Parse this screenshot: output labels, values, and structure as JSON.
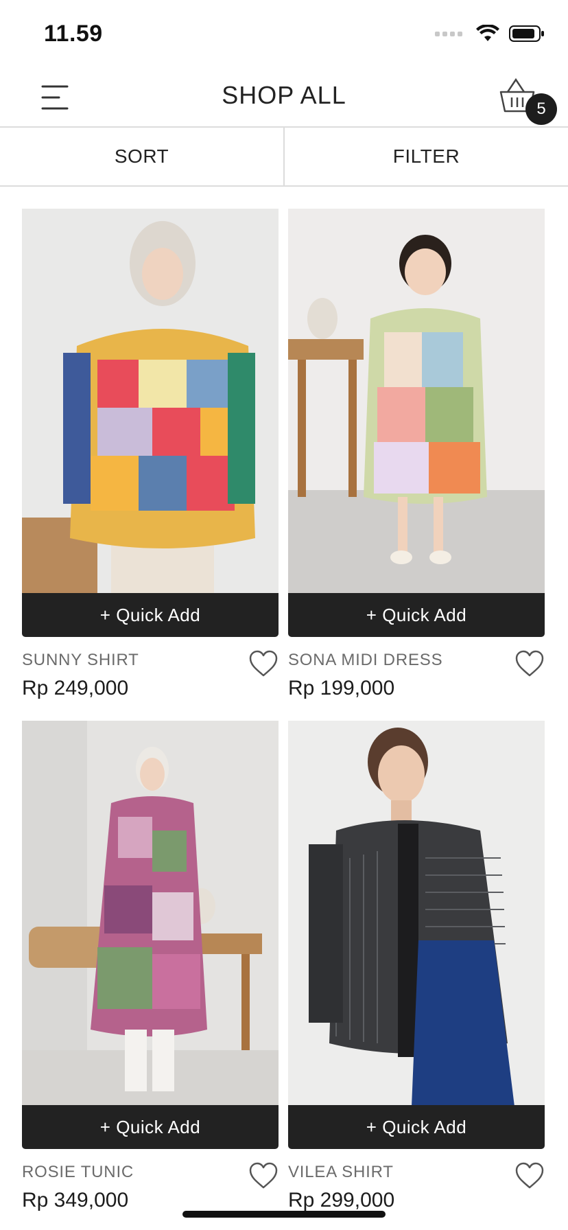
{
  "status_bar": {
    "time": "11.59"
  },
  "header": {
    "title": "SHOP ALL",
    "cart_count": "5",
    "menu_icon": "hamburger-menu-icon",
    "cart_icon": "basket-icon"
  },
  "toolbar": {
    "sort_label": "SORT",
    "filter_label": "FILTER"
  },
  "products": [
    {
      "name": "SUNNY SHIRT",
      "price": "Rp 249,000",
      "quick_add": "+ Quick Add"
    },
    {
      "name": "SONA MIDI DRESS",
      "price": "Rp 199,000",
      "quick_add": "+ Quick Add"
    },
    {
      "name": "ROSIE TUNIC",
      "price": "Rp 349,000",
      "quick_add": "+ Quick Add"
    },
    {
      "name": "VILEA SHIRT",
      "price": "Rp 299,000",
      "quick_add": "+ Quick Add"
    }
  ],
  "colors": {
    "button_dark": "#222222",
    "badge": "#1d1d1d",
    "muted_text": "#6b6b6b"
  }
}
